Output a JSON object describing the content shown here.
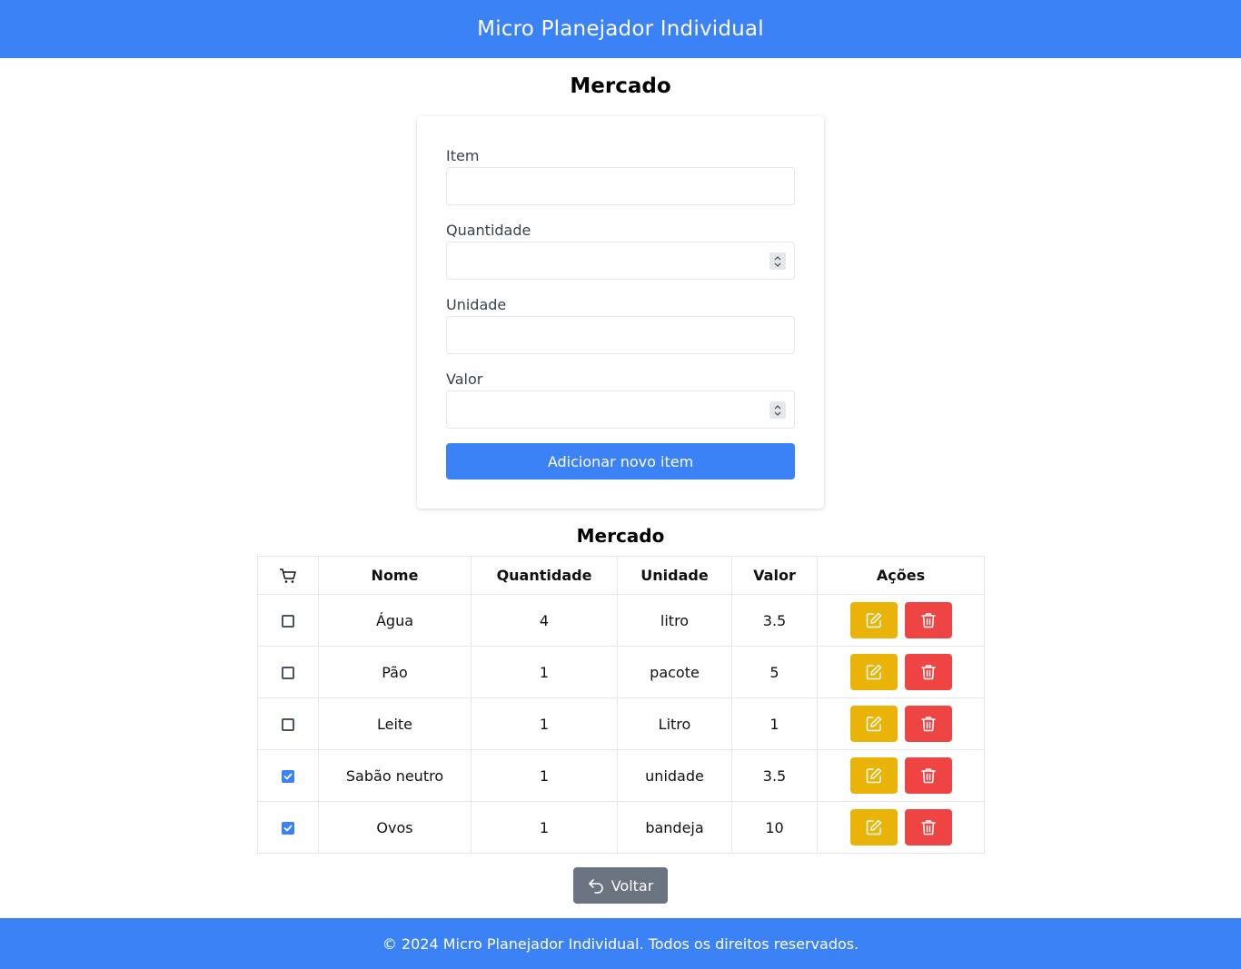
{
  "header": {
    "title": "Micro Planejador Individual"
  },
  "page": {
    "title": "Mercado"
  },
  "form": {
    "item_label": "Item",
    "item_value": "",
    "quantidade_label": "Quantidade",
    "quantidade_value": "",
    "unidade_label": "Unidade",
    "unidade_value": "",
    "valor_label": "Valor",
    "valor_value": "",
    "submit_label": "Adicionar novo item"
  },
  "table": {
    "title": "Mercado",
    "columns": [
      "cart-icon",
      "Nome",
      "Quantidade",
      "Unidade",
      "Valor",
      "Ações"
    ],
    "rows": [
      {
        "checked": false,
        "nome": "Água",
        "quantidade": "4",
        "unidade": "litro",
        "valor": "3.5"
      },
      {
        "checked": false,
        "nome": "Pão",
        "quantidade": "1",
        "unidade": "pacote",
        "valor": "5"
      },
      {
        "checked": false,
        "nome": "Leite",
        "quantidade": "1",
        "unidade": "Litro",
        "valor": "1"
      },
      {
        "checked": true,
        "nome": "Sabão neutro",
        "quantidade": "1",
        "unidade": "unidade",
        "valor": "3.5"
      },
      {
        "checked": true,
        "nome": "Ovos",
        "quantidade": "1",
        "unidade": "bandeja",
        "valor": "10"
      }
    ],
    "actions": {
      "edit_icon": "pencil-square-icon",
      "delete_icon": "trash-icon"
    }
  },
  "back_button": {
    "label": "Voltar",
    "icon": "undo-arrow-icon"
  },
  "footer": {
    "text": "© 2024 Micro Planejador Individual. Todos os direitos reservados."
  },
  "colors": {
    "primary": "#3b82f6",
    "edit": "#eab308",
    "delete": "#ef4444",
    "secondary": "#6b7280"
  }
}
